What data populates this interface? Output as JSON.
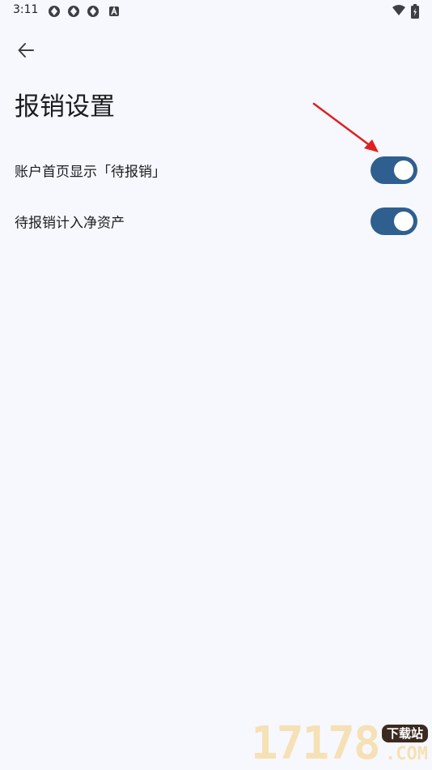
{
  "status_bar": {
    "time": "3:11",
    "notification_icons": [
      "aperture-icon",
      "aperture-icon",
      "aperture-icon",
      "a-badge-icon"
    ],
    "right_icons": [
      "wifi-icon",
      "battery-charging-icon"
    ]
  },
  "header": {
    "back_icon": "arrow-left-icon",
    "title": "报销设置"
  },
  "settings": [
    {
      "label": "账户首页显示「待报销」",
      "enabled": true
    },
    {
      "label": "待报销计入净资产",
      "enabled": true
    }
  ],
  "colors": {
    "background": "#f7f8fd",
    "switch_track_on": "#2f5f8f",
    "switch_thumb": "#ffffff",
    "annotation_arrow": "#e02020"
  },
  "watermark": {
    "digits": "17178",
    "badge": "下载站",
    "suffix": ".COM"
  }
}
